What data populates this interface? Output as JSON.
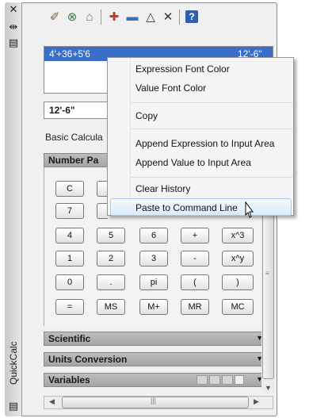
{
  "strip": {
    "close_glyph": "✕",
    "autohide_glyph": "⇹",
    "properties_glyph": "▤",
    "title": "QuickCalc",
    "bottom_glyph": "▤"
  },
  "toolbar": [
    {
      "name": "clear-icon",
      "glyph": "✐",
      "color": "#7a5b3c"
    },
    {
      "name": "clear-history-icon",
      "glyph": "⊗",
      "color": "#3c7a3c"
    },
    {
      "name": "paste-value-icon",
      "glyph": "⌂",
      "color": "#4a6fb5"
    },
    {
      "name": "get-coordinates-icon",
      "glyph": "✚",
      "color": "#c0392b"
    },
    {
      "name": "distance-icon",
      "glyph": "▬",
      "color": "#3c6fb5"
    },
    {
      "name": "angle-icon",
      "glyph": "△",
      "color": "#333333"
    },
    {
      "name": "intersection-icon",
      "glyph": "✕",
      "color": "#333333"
    },
    {
      "name": "help-icon",
      "glyph": "?",
      "color": "#ffffff"
    }
  ],
  "history": {
    "expression": "4'+36+5'6",
    "value": "12'-6\""
  },
  "input": {
    "value": "12'-6\""
  },
  "basic_calculator_label": "Basic Calcula",
  "sections": {
    "number_pad": "Number Pa",
    "scientific": "Scientific",
    "units_conversion": "Units Conversion",
    "variables": "Variables"
  },
  "keys": [
    [
      "C",
      "",
      "",
      "",
      ""
    ],
    [
      "7",
      "",
      "",
      "",
      ""
    ],
    [
      "4",
      "5",
      "6",
      "+",
      "x^3"
    ],
    [
      "1",
      "2",
      "3",
      "-",
      "x^y"
    ],
    [
      "0",
      ".",
      "pi",
      "(",
      ")"
    ],
    [
      "=",
      "MS",
      "M+",
      "MR",
      "MC"
    ]
  ],
  "context_menu": [
    "Expression Font Color",
    "Value Font Color",
    "Copy",
    "Append Expression to Input Area",
    "Append Value to Input Area",
    "Clear History",
    "Paste to Command Line"
  ],
  "colors": {
    "selection": "#3a6ec9",
    "section_header": "#a5a5a5",
    "menu_hover": "#dcebfc"
  }
}
